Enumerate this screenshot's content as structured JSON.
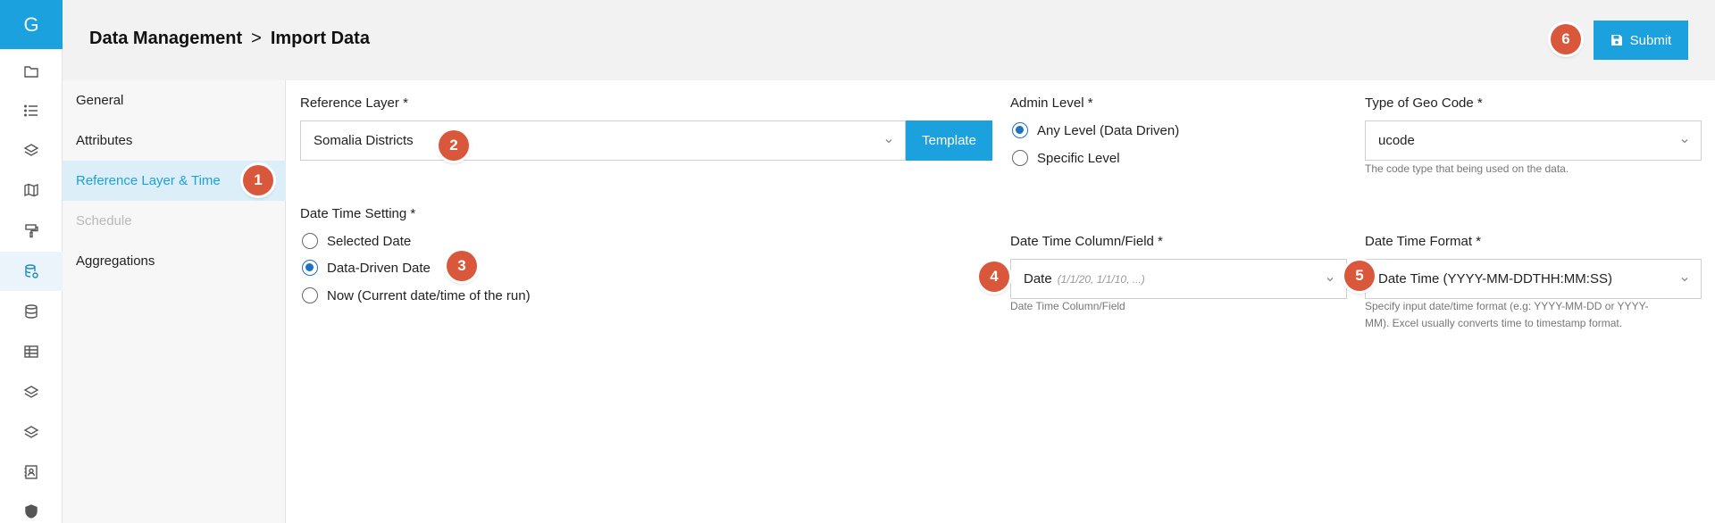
{
  "rail": {
    "logo": "G",
    "icons": [
      "folder-icon",
      "list-icon",
      "layers-icon",
      "map-icon",
      "paint-roller-icon",
      "database-import-icon",
      "database-icon",
      "table-icon",
      "layers-icon",
      "layers-icon",
      "contact-book-icon",
      "shield-icon"
    ]
  },
  "header": {
    "crumb_parent": "Data Management",
    "crumb_sep": ">",
    "crumb_current": "Import Data",
    "submit_label": "Submit"
  },
  "markers": [
    "1",
    "2",
    "3",
    "4",
    "5",
    "6"
  ],
  "sidenav": {
    "items": [
      {
        "label": "General",
        "state": "normal"
      },
      {
        "label": "Attributes",
        "state": "normal"
      },
      {
        "label": "Reference Layer & Time",
        "state": "active"
      },
      {
        "label": "Schedule",
        "state": "disabled"
      },
      {
        "label": "Aggregations",
        "state": "normal"
      }
    ]
  },
  "form": {
    "reference_layer": {
      "label": "Reference Layer *",
      "value": "Somalia Districts",
      "template_label": "Template"
    },
    "admin_level": {
      "label": "Admin Level *",
      "options": [
        "Any Level (Data Driven)",
        "Specific Level"
      ],
      "selected": 0
    },
    "geo_code": {
      "label": "Type of Geo Code *",
      "value": "ucode",
      "hint": "The code type that being used on the data."
    },
    "date_time_setting": {
      "label": "Date Time Setting *",
      "options": [
        "Selected Date",
        "Data-Driven Date",
        "Now (Current date/time of the run)"
      ],
      "selected": 1
    },
    "date_time_column": {
      "label": "Date Time Column/Field *",
      "value": "Date",
      "value_hint": "(1/1/20, 1/1/10, ...)",
      "hint": "Date Time Column/Field"
    },
    "date_time_format": {
      "label": "Date Time Format *",
      "value": "Date Time (YYYY-MM-DDTHH:MM:SS)",
      "hint_line1": "Specify input date/time format (e.g: YYYY-MM-DD or YYYY-",
      "hint_line2": "MM). Excel usually converts time to timestamp format."
    }
  },
  "colors": {
    "accent": "#1ba1dd",
    "marker": "#d9573a",
    "radio": "#1a73c4"
  }
}
